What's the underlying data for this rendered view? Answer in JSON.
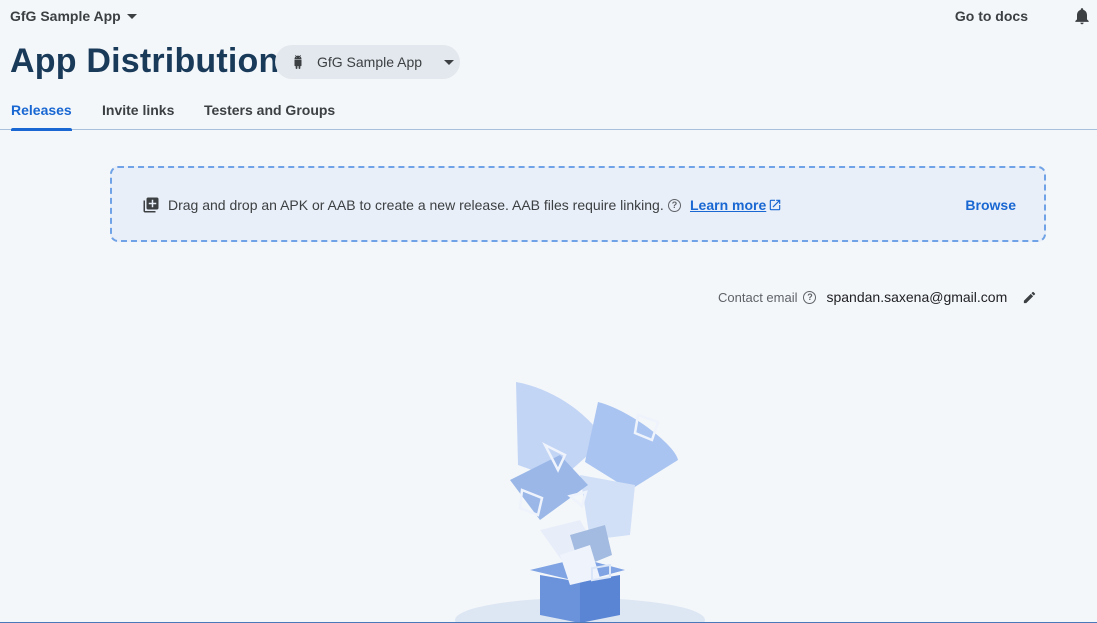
{
  "topbar": {
    "project_name": "GfG Sample App",
    "docs_link": "Go to docs",
    "bell_icon": "notifications-icon"
  },
  "header": {
    "title": "App Distribution",
    "app_selector": "GfG Sample App",
    "app_icon": "android-icon"
  },
  "tabs": [
    {
      "label": "Releases",
      "active": true
    },
    {
      "label": "Invite links",
      "active": false
    },
    {
      "label": "Testers and Groups",
      "active": false
    }
  ],
  "dropzone": {
    "icon": "add-to-library-icon",
    "text": "Drag and drop an APK or AAB to create a new release. AAB files require linking.",
    "help_icon": "help-icon",
    "learn_more": "Learn more",
    "learn_more_icon": "open-in-new-icon",
    "browse": "Browse"
  },
  "contact": {
    "label": "Contact email",
    "email": "spandan.saxena@gmail.com",
    "edit_icon": "edit-icon"
  },
  "colors": {
    "accent": "#1967d2",
    "title": "#1a3a5a",
    "background": "#f4f7fa",
    "dropzone_border": "#6fa2e6"
  }
}
